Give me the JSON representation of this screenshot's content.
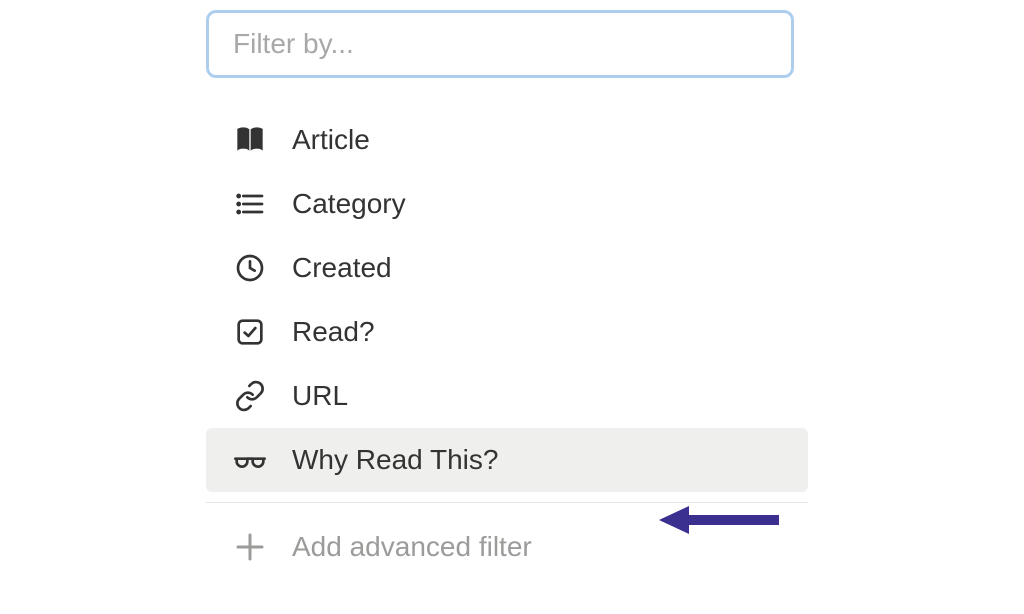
{
  "filter": {
    "placeholder": "Filter by...",
    "items": [
      {
        "label": "Article"
      },
      {
        "label": "Category"
      },
      {
        "label": "Created"
      },
      {
        "label": "Read?"
      },
      {
        "label": "URL"
      },
      {
        "label": "Why Read This?"
      }
    ],
    "advanced_label": "Add advanced filter"
  }
}
